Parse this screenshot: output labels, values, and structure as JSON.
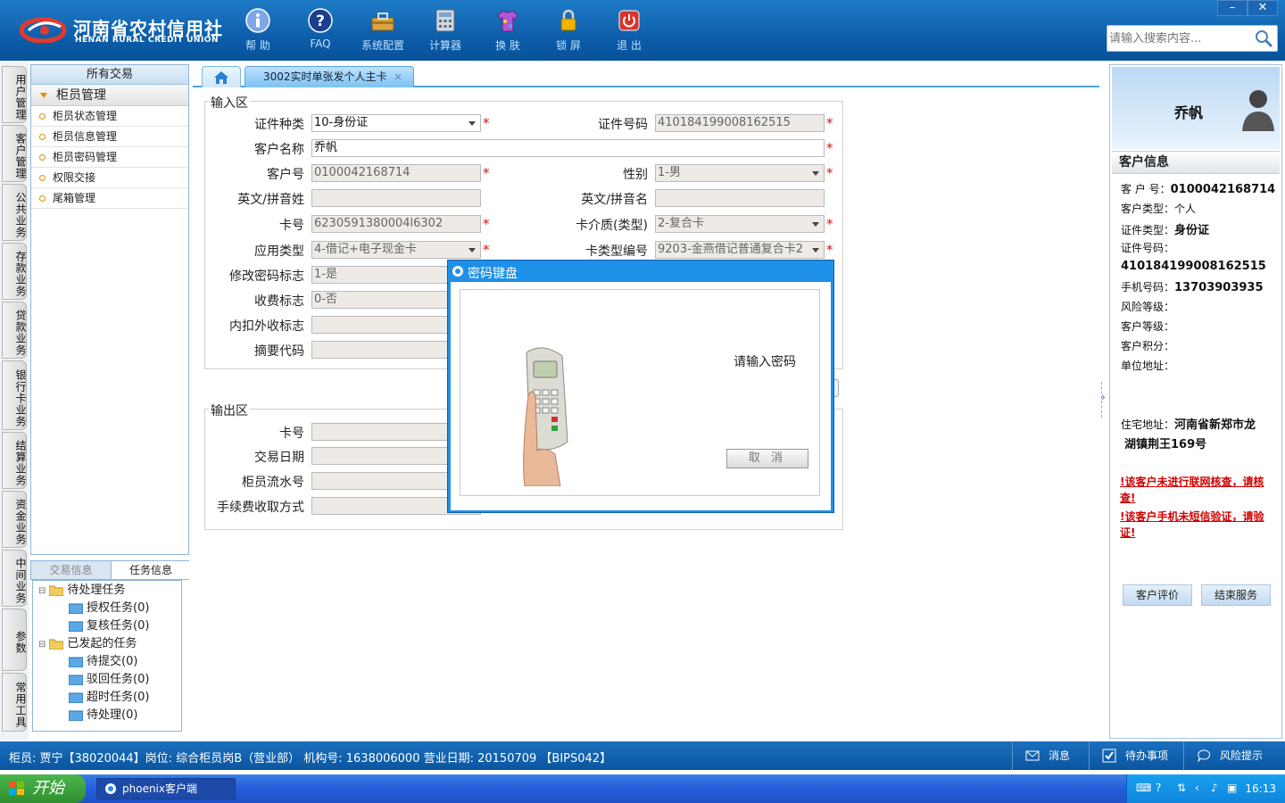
{
  "header": {
    "logo_cn": "河南省农村信用社",
    "logo_en": "HENAN RURAL CREDIT UNION",
    "toolbar": [
      {
        "label": "帮 助",
        "icon": "info-icon"
      },
      {
        "label": "FAQ",
        "icon": "faq-icon"
      },
      {
        "label": "系统配置",
        "icon": "toolbox-icon"
      },
      {
        "label": "计算器",
        "icon": "calculator-icon"
      },
      {
        "label": "换 肤",
        "icon": "shirt-icon"
      },
      {
        "label": "锁 屏",
        "icon": "lock-icon"
      },
      {
        "label": "退 出",
        "icon": "power-icon"
      }
    ],
    "search_placeholder": "请输入搜索内容...",
    "minimize": "–",
    "close": "✕"
  },
  "left_tabs": [
    "用户管理",
    "客户管理",
    "公共业务",
    "存款业务",
    "贷款业务",
    "银行卡业务",
    "结算业务",
    "资金业务",
    "中间业务",
    "参数",
    "常用工具"
  ],
  "nav": {
    "header": "所有交易",
    "group": "柜员管理",
    "items": [
      "柜员状态管理",
      "柜员信息管理",
      "柜员密码管理",
      "权限交接",
      "尾箱管理"
    ]
  },
  "bottom_tabs": [
    "交易信息",
    "任务信息"
  ],
  "tasks": {
    "pending": "待处理任务",
    "pending_children": [
      "授权任务(0)",
      "复核任务(0)"
    ],
    "initiated": "已发起的任务",
    "initiated_children": [
      "待提交(0)",
      "驳回任务(0)",
      "超时任务(0)",
      "待处理(0)"
    ]
  },
  "tabs": {
    "active": "3002实时单张发个人主卡",
    "close": "×"
  },
  "input_area": {
    "legend": "输入区",
    "id_type_label": "证件种类",
    "id_type": "10-身份证",
    "id_no_label": "证件号码",
    "id_no": "410184199008162515",
    "cust_name_label": "客户名称",
    "cust_name": "乔帆",
    "cust_no_label": "客户号",
    "cust_no": "0100042168714",
    "gender_label": "性别",
    "gender": "1-男",
    "en_surname_label": "英文/拼音姓",
    "en_name_label": "英文/拼音名",
    "card_no_label": "卡号",
    "card_no": "6230591380004l6302",
    "card_medium_label": "卡介质(类型)",
    "card_medium": "2-复合卡",
    "app_type_label": "应用类型",
    "app_type": "4-借记+电子现金卡",
    "card_type_no_label": "卡类型编号",
    "card_type_no": "9203-金燕借记普通复合卡2",
    "pwd_flag_label": "修改密码标志",
    "pwd_flag": "1-是",
    "fee_flag_label": "收费标志",
    "fee_flag": "0-否",
    "inner_fee_label": "内扣外收标志",
    "summary_code_label": "摘要代码",
    "required": "*"
  },
  "output_area": {
    "legend": "输出区",
    "card_no_label": "卡号",
    "trans_date_label": "交易日期",
    "teller_serial_label": "柜员流水号",
    "fee_method_label": "手续费收取方式"
  },
  "dialog": {
    "title": "密码键盘",
    "prompt": "请输入密码",
    "cancel": "取 消"
  },
  "customer": {
    "name": "乔帆",
    "section": "客户信息",
    "cust_no_label": "客 户 号：",
    "cust_no": "0100042168714",
    "cust_type_label": "客户类型：",
    "cust_type": "个人",
    "id_type_label": "证件类型：",
    "id_type": "身份证",
    "id_no_label": "证件号码：",
    "id_no": "410184199008162515",
    "phone_label": "手机号码：",
    "phone": "13703903935",
    "risk_label": "风险等级：",
    "level_label": "客户等级：",
    "points_label": "客户积分：",
    "company_label": "单位地址：",
    "address_label": "住宅地址：",
    "address_line1": "河南省新郑市龙",
    "address_line2": "湖镇荆王169号",
    "warn1": "!该客户未进行联网核查，请核查!",
    "warn2": "!该客户手机未短信验证，请验证!",
    "eval_btn": "客户评价",
    "end_btn": "结束服务"
  },
  "status": {
    "text": "柜员: 贾宁【38020044】岗位: 综合柜员岗B（营业部） 机构号: 1638006000  营业日期: 20150709 【BIPS042】",
    "msg": "消息",
    "todo": "待办事项",
    "risk": "风险提示"
  },
  "taskbar": {
    "start": "开始",
    "app": "phoenix客户端",
    "clock": "16:13"
  },
  "colors": {
    "header_blue": "#0b5aa6",
    "accent": "#1e90e8",
    "required": "#d11111",
    "warning": "#d10000"
  }
}
